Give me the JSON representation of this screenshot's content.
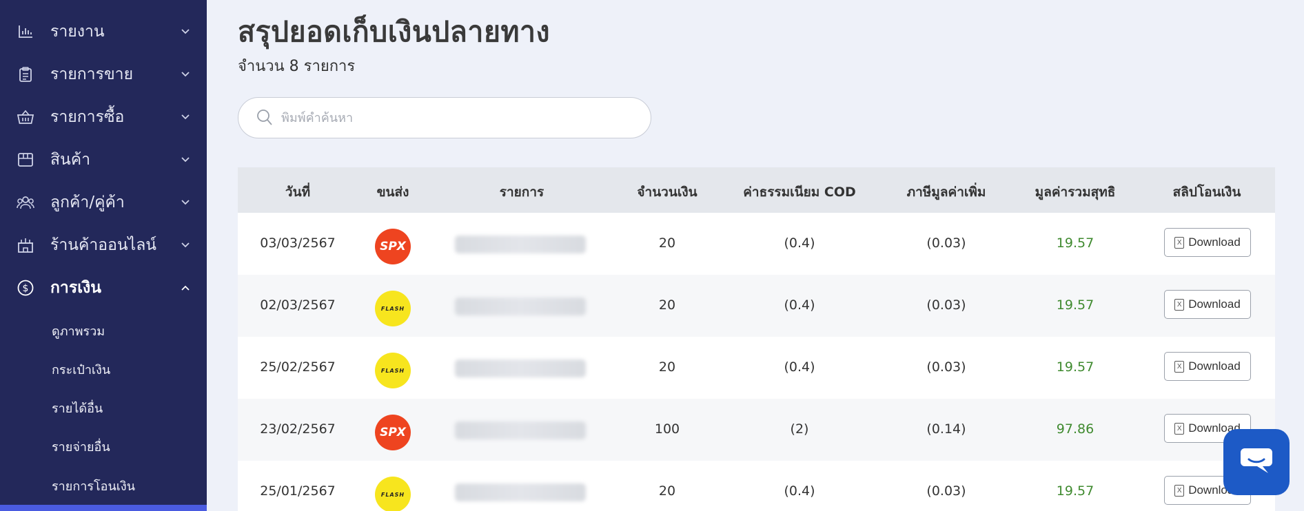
{
  "sidebar": {
    "items": [
      {
        "label": "รายงาน",
        "icon": "chart-bar-icon"
      },
      {
        "label": "รายการขาย",
        "icon": "clipboard-icon"
      },
      {
        "label": "รายการซื้อ",
        "icon": "basket-icon"
      },
      {
        "label": "สินค้า",
        "icon": "box-icon"
      },
      {
        "label": "ลูกค้า/คู่ค้า",
        "icon": "users-icon"
      },
      {
        "label": "ร้านค้าออนไลน์",
        "icon": "store-icon"
      },
      {
        "label": "การเงิน",
        "icon": "dollar-circle-icon"
      }
    ],
    "sub_items": [
      {
        "label": "ดูภาพรวม"
      },
      {
        "label": "กระเป๋าเงิน"
      },
      {
        "label": "รายได้อื่น"
      },
      {
        "label": "รายจ่ายอื่น"
      },
      {
        "label": "รายการโอนเงิน"
      }
    ]
  },
  "page": {
    "title": "สรุปยอดเก็บเงินปลายทาง",
    "subtitle": "จำนวน 8 รายการ"
  },
  "search": {
    "placeholder": "พิมพ์คำค้นหา"
  },
  "table": {
    "headers": [
      "วันที่",
      "ขนส่ง",
      "รายการ",
      "จำนวนเงิน",
      "ค่าธรรมเนียม COD",
      "ภาษีมูลค่าเพิ่ม",
      "มูลค่ารวมสุทธิ",
      "สลิปโอนเงิน"
    ],
    "rows": [
      {
        "date": "03/03/2567",
        "carrier": "SPX",
        "amount": "20",
        "fee": "(0.4)",
        "vat": "(0.03)",
        "net": "19.57",
        "slip": "Download"
      },
      {
        "date": "02/03/2567",
        "carrier": "FLASH",
        "amount": "20",
        "fee": "(0.4)",
        "vat": "(0.03)",
        "net": "19.57",
        "slip": "Download"
      },
      {
        "date": "25/02/2567",
        "carrier": "FLASH",
        "amount": "20",
        "fee": "(0.4)",
        "vat": "(0.03)",
        "net": "19.57",
        "slip": "Download"
      },
      {
        "date": "23/02/2567",
        "carrier": "SPX",
        "amount": "100",
        "fee": "(2)",
        "vat": "(0.14)",
        "net": "97.86",
        "slip": "Download"
      },
      {
        "date": "25/01/2567",
        "carrier": "FLASH",
        "amount": "20",
        "fee": "(0.4)",
        "vat": "(0.03)",
        "net": "19.57",
        "slip": "Download"
      }
    ]
  },
  "colors": {
    "sidebar_bg": "#23285a",
    "net_value": "#3f8a2f",
    "spx_brand": "#ee4420",
    "flash_brand": "#f7e51e",
    "chat_button": "#1d5ac6"
  }
}
